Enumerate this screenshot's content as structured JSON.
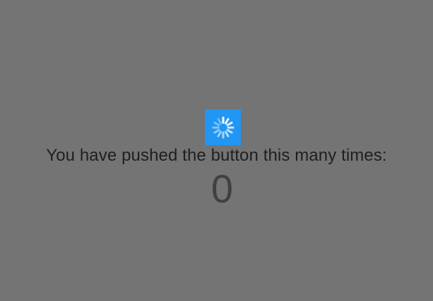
{
  "overlay": {
    "background_color": "#747474"
  },
  "loading_indicator": {
    "icon": "spinner-icon",
    "background_color": "#2196F3",
    "spoke_color": "#ffffff"
  },
  "content": {
    "message": "You have pushed the button this many times:",
    "counter": "0"
  }
}
